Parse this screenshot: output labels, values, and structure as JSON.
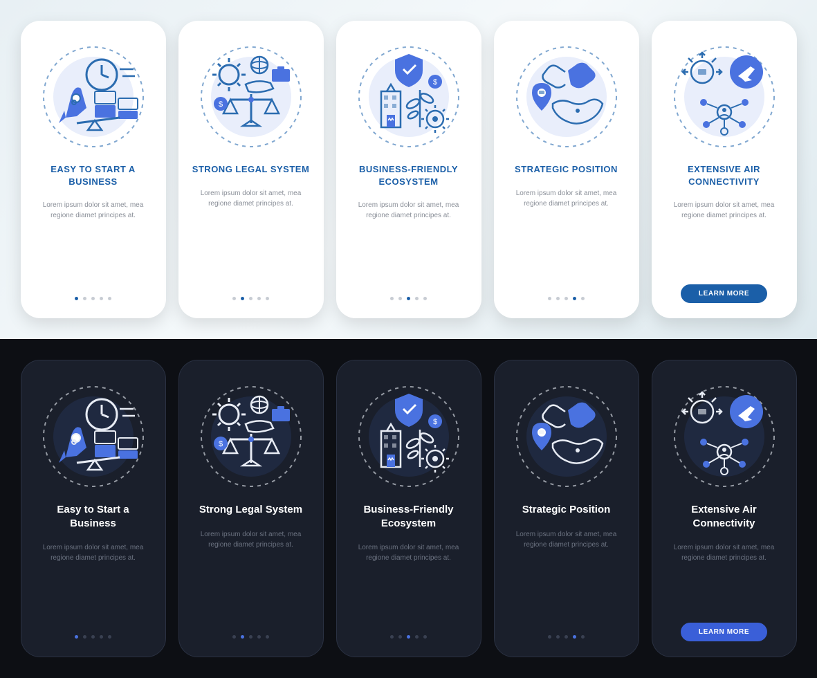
{
  "body_text": "Lorem ipsum dolor sit amet, mea regione diamet principes at.",
  "cta_label": "LEARN MORE",
  "colors": {
    "accent_light": "#1b5fa8",
    "accent_dark": "#4a72e0",
    "accent_dark2": "#3a5fd8"
  },
  "light": {
    "cards": [
      {
        "title": "EASY TO START A BUSINESS",
        "icon": "rocket-clock-icon",
        "active_dot": 0
      },
      {
        "title": "STRONG LEGAL SYSTEM",
        "icon": "scales-gear-icon",
        "active_dot": 1
      },
      {
        "title": "BUSINESS-FRIENDLY ECOSYSTEM",
        "icon": "shield-plant-icon",
        "active_dot": 2
      },
      {
        "title": "STRATEGIC POSITION",
        "icon": "map-handshake-icon",
        "active_dot": 3
      },
      {
        "title": "EXTENSIVE AIR CONNECTIVITY",
        "icon": "network-plane-icon",
        "active_dot": -1
      }
    ]
  },
  "dark": {
    "cards": [
      {
        "title": "Easy to Start a Business",
        "icon": "rocket-clock-icon",
        "active_dot": 0
      },
      {
        "title": "Strong Legal System",
        "icon": "scales-gear-icon",
        "active_dot": 1
      },
      {
        "title": "Business-Friendly Ecosystem",
        "icon": "shield-plant-icon",
        "active_dot": 2
      },
      {
        "title": "Strategic Position",
        "icon": "map-handshake-icon",
        "active_dot": 3
      },
      {
        "title": "Extensive Air Connectivity",
        "icon": "network-plane-icon",
        "active_dot": -1
      }
    ]
  }
}
